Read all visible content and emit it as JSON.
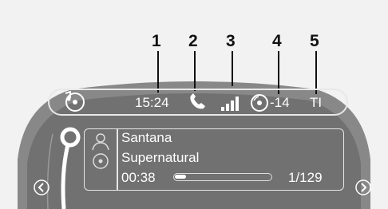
{
  "callouts": [
    "1",
    "2",
    "3",
    "4",
    "5"
  ],
  "status_bar": {
    "time": "15:24",
    "volume": "-14",
    "ti": "TI"
  },
  "media": {
    "artist": "Santana",
    "album": "Supernatural",
    "elapsed": "00:38",
    "track": "1/129",
    "progress": 0.12
  },
  "colors": {
    "display_bg": "#717171",
    "outer_ring": "#898989",
    "text": "#ffffff"
  },
  "icons": [
    "cd-music-icon",
    "phone-icon",
    "signal-strength-icon",
    "cd-icon",
    "artist-icon",
    "album-icon",
    "left-arrow-icon",
    "right-arrow-icon"
  ]
}
